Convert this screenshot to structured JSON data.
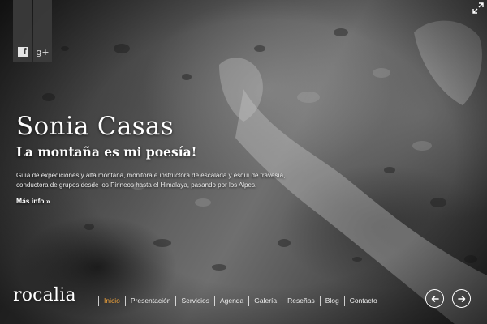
{
  "hero": {
    "title": "Sonia Casas",
    "subtitle": "La montaña es mi poesía!",
    "description": "Guía de expediciones y alta montaña, monitora e instructora de escalada y esquí de travesía, conductora de grupos desde los Pirineos hasta el Himalaya, pasando por los Alpes.",
    "more_link": "Más info »"
  },
  "social": {
    "facebook_icon": "facebook-icon",
    "google_plus_icon": "google-plus-icon",
    "google_plus_glyph": "g+"
  },
  "footer": {
    "logo": "rocalia",
    "nav": [
      {
        "label": "Inicio",
        "active": true
      },
      {
        "label": "Presentación"
      },
      {
        "label": "Servicios"
      },
      {
        "label": "Agenda"
      },
      {
        "label": "Galería"
      },
      {
        "label": "Reseñas"
      },
      {
        "label": "Blog"
      },
      {
        "label": "Contacto"
      }
    ],
    "prev_icon": "arrow-left-icon",
    "next_icon": "arrow-right-icon"
  },
  "colors": {
    "active_nav": "#f2a43a",
    "text": "#ffffff",
    "social_bg": "#3c3c3c"
  }
}
